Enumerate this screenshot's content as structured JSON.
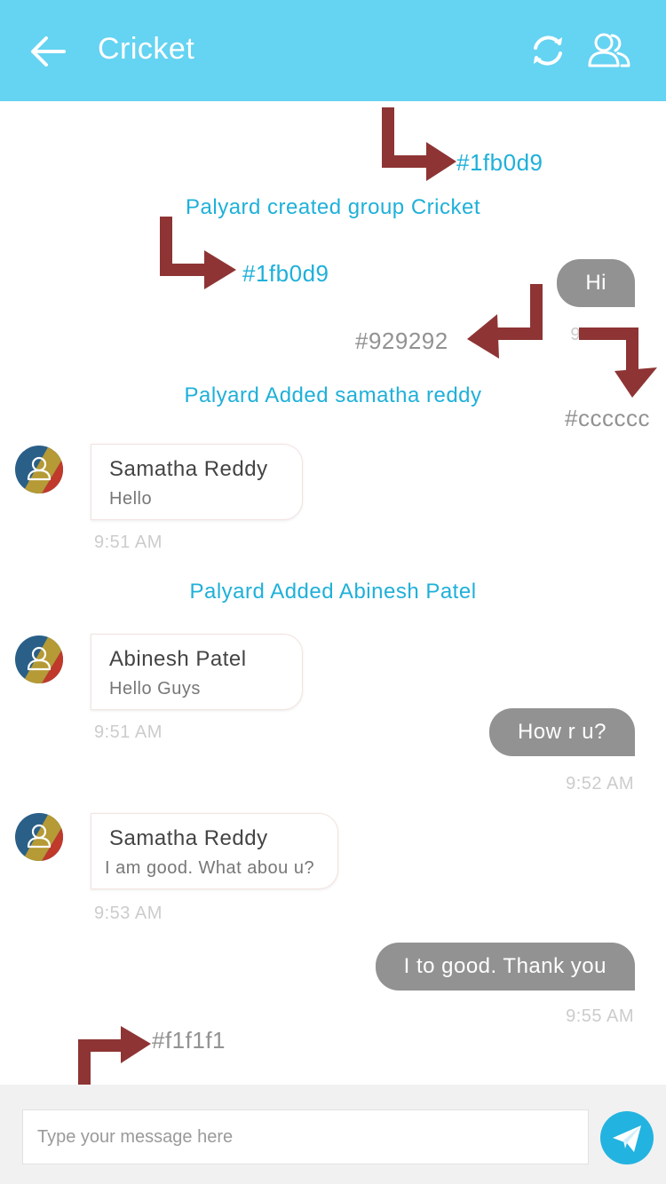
{
  "header": {
    "title": "Cricket"
  },
  "messages": {
    "sys_created": "Palyard created group Cricket",
    "out_hi": {
      "text": "Hi",
      "time": "9:"
    },
    "sys_added_1": "Palyard Added samatha reddy",
    "in_1": {
      "sender": "Samatha Reddy",
      "text": "Hello",
      "time": "9:51 AM"
    },
    "sys_added_2": "Palyard Added Abinesh Patel",
    "in_2": {
      "sender": "Abinesh Patel",
      "text": "Hello Guys",
      "time": "9:51 AM"
    },
    "out_2": {
      "text": "How r u?",
      "time": "9:52 AM"
    },
    "in_3": {
      "sender": "Samatha Reddy",
      "text": "I am good. What abou u?",
      "time": "9:53 AM"
    },
    "out_3": {
      "text": "I to good. Thank you",
      "time": "9:55 AM"
    }
  },
  "annotations": {
    "a1": "#1fb0d9",
    "a2": "#1fb0d9",
    "a3": "#929292",
    "a4": "#cccccc",
    "a5": "#f1f1f1"
  },
  "composer": {
    "placeholder": "Type your message here"
  },
  "colors": {
    "header": "#65d3f2",
    "system_text": "#1fb0d9",
    "outgoing_bubble": "#929292",
    "timestamp": "#cccccc",
    "footer": "#f1f1f1",
    "send_button": "#23b3e0",
    "annotation_arrow": "#8e3434"
  },
  "icons": {
    "back": "arrow-left-icon",
    "refresh": "refresh-icon",
    "group": "group-icon",
    "avatar": "user-avatar-icon",
    "send": "paper-plane-icon"
  }
}
